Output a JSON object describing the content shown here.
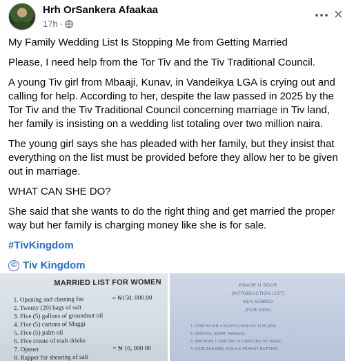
{
  "post": {
    "author": "Hrh OrSankera Afaakaa",
    "time": "17h",
    "separator": "·",
    "more_icon": "more-horizontal-icon",
    "close_symbol": "×",
    "paragraphs": [
      "My Family Wedding List Is Stopping Me from Getting Married",
      "Please, I need help from the Tor Tiv and the Tiv Traditional Council.",
      "A young Tiv girl from Mbaaji, Kunav, in Vandeikya LGA is crying out and calling for help. According to her, despite the law passed in 2025 by the Tor Tiv and the Tiv Traditional Council concerning marriage in Tiv land, her family is insisting on a wedding list totaling over two million naira.",
      "The young girl says she has pleaded with her family, but they insist that everything on the list must be provided before they allow her to be given out in marriage.",
      "WHAT CAN SHE DO?",
      "She said that she wants to do the right thing and get married the proper way but her family is charging money like she is for sale."
    ],
    "hashtag": "#TivKingdom",
    "mention_symbol": "©",
    "mention": "Tiv Kingdom"
  },
  "photo_left": {
    "title": "MARRIED LIST FOR WOMEN",
    "items": [
      {
        "text": "1.  Opening and classing fee",
        "amount": "= ₦150, 000.00"
      },
      {
        "text": "2.  Twenty (20) bags of salt",
        "amount": ""
      },
      {
        "text": "3.  Five (5) gallons of groundnut oil",
        "amount": ""
      },
      {
        "text": "4.  Five (5) cartons of Maggi",
        "amount": ""
      },
      {
        "text": "5.  Five (5) palm oil",
        "amount": ""
      },
      {
        "text": "6.  Five create of malt drinks",
        "amount": ""
      },
      {
        "text": "7.  Opener",
        "amount": "= ₦ 10, 000 00"
      },
      {
        "text": "8.  Rapper for shearing of salt",
        "amount": ""
      }
    ]
  },
  "photo_right": {
    "heads": [
      "KWASE U SOOR",
      "(INTRODUCTION LIST)",
      "KEN NOMSO",
      "(FOR MEN)"
    ],
    "rows": [
      "1.   IYAM NYIAR          = 50,000 (CASH OF N 50,000)",
      "2.   NGOVOL (GOAT FEMALE)",
      "3.   MBORUM 1 CARTON IS CARTONS OF BEER)",
      "4.   IKUE SHA MBE (KOLA & PEANUT BUTTER)"
    ]
  }
}
